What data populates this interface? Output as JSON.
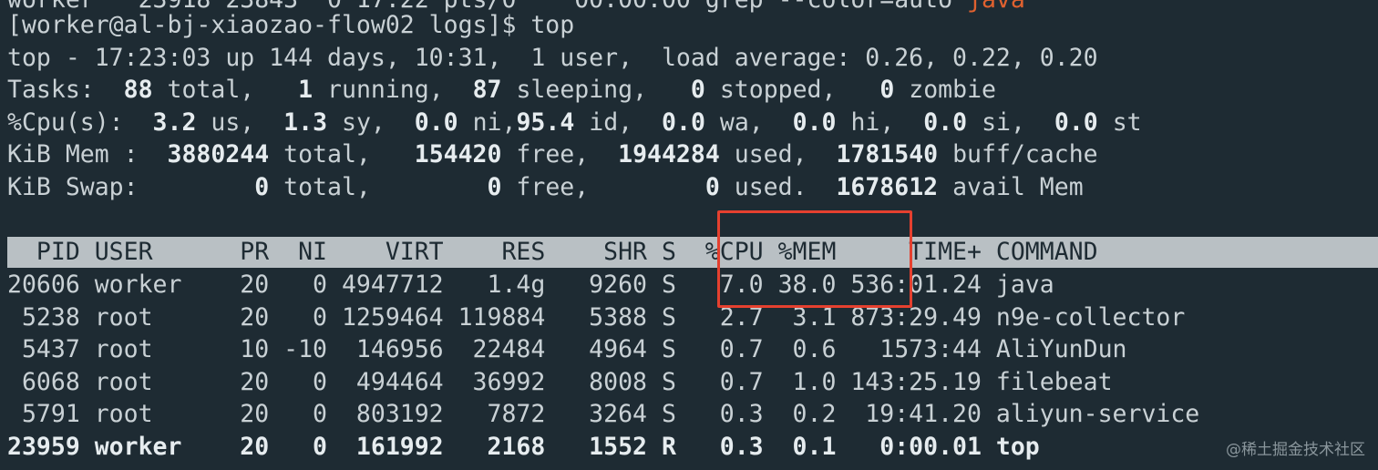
{
  "top_partial": "worker   23918 23843  0 17:22 pts/0    00:00:00 grep --color=auto ",
  "top_partial_highlight": "java",
  "prompt": "[worker@al-bj-xiaozao-flow02 logs]$ top",
  "summary": {
    "uptime_line": "top - 17:23:03 up 144 days, 10:31,  1 user,  load average: 0.26, 0.22, 0.20",
    "tasks": {
      "label": "Tasks: ",
      "total": " 88",
      "total_label": " total, ",
      "running": "  1",
      "running_label": " running, ",
      "sleeping": " 87",
      "sleeping_label": " sleeping, ",
      "stopped": "  0",
      "stopped_label": " stopped, ",
      "zombie": "  0",
      "zombie_label": " zombie"
    },
    "cpu": {
      "label": "%Cpu(s): ",
      "us": " 3.2",
      "us_label": " us, ",
      "sy": " 1.3",
      "sy_label": " sy, ",
      "ni": " 0.0",
      "ni_label": " ni,",
      "id": "95.4",
      "id_label": " id, ",
      "wa": " 0.0",
      "wa_label": " wa, ",
      "hi": " 0.0",
      "hi_label": " hi, ",
      "si": " 0.0",
      "si_label": " si, ",
      "st": " 0.0",
      "st_label": " st"
    },
    "mem": {
      "label": "KiB Mem : ",
      "total": " 3880244",
      "total_label": " total, ",
      "free": "  154420",
      "free_label": " free, ",
      "used": " 1944284",
      "used_label": " used, ",
      "cache": " 1781540",
      "cache_label": " buff/cache"
    },
    "swap": {
      "label": "KiB Swap:",
      "total": "        0",
      "total_label": " total, ",
      "free": "       0",
      "free_label": " free, ",
      "used": "       0",
      "used_label": " used. ",
      "avail": " 1678612",
      "avail_label": " avail Mem"
    }
  },
  "header": "  PID USER      PR  NI    VIRT    RES    SHR S  %CPU %MEM     TIME+ COMMAND",
  "processes": [
    "20606 worker    20   0 4947712   1.4g   9260 S   7.0 38.0 536:01.24 java",
    " 5238 root      20   0 1259464 119884   5388 S   2.7  3.1 873:29.49 n9e-collector",
    " 5437 root      10 -10  146956  22484   4964 S   0.7  0.6   1573:44 AliYunDun",
    " 6068 root      20   0  494464  36992   8008 S   0.7  1.0 143:25.19 filebeat",
    " 5791 root      20   0  803192   7872   3264 S   0.3  0.2  19:41.20 aliyun-service",
    "23959 worker    20   0  161992   2168   1552 R   0.3  0.1   0:00.01 top"
  ],
  "watermark": "@稀土掘金技术社区"
}
